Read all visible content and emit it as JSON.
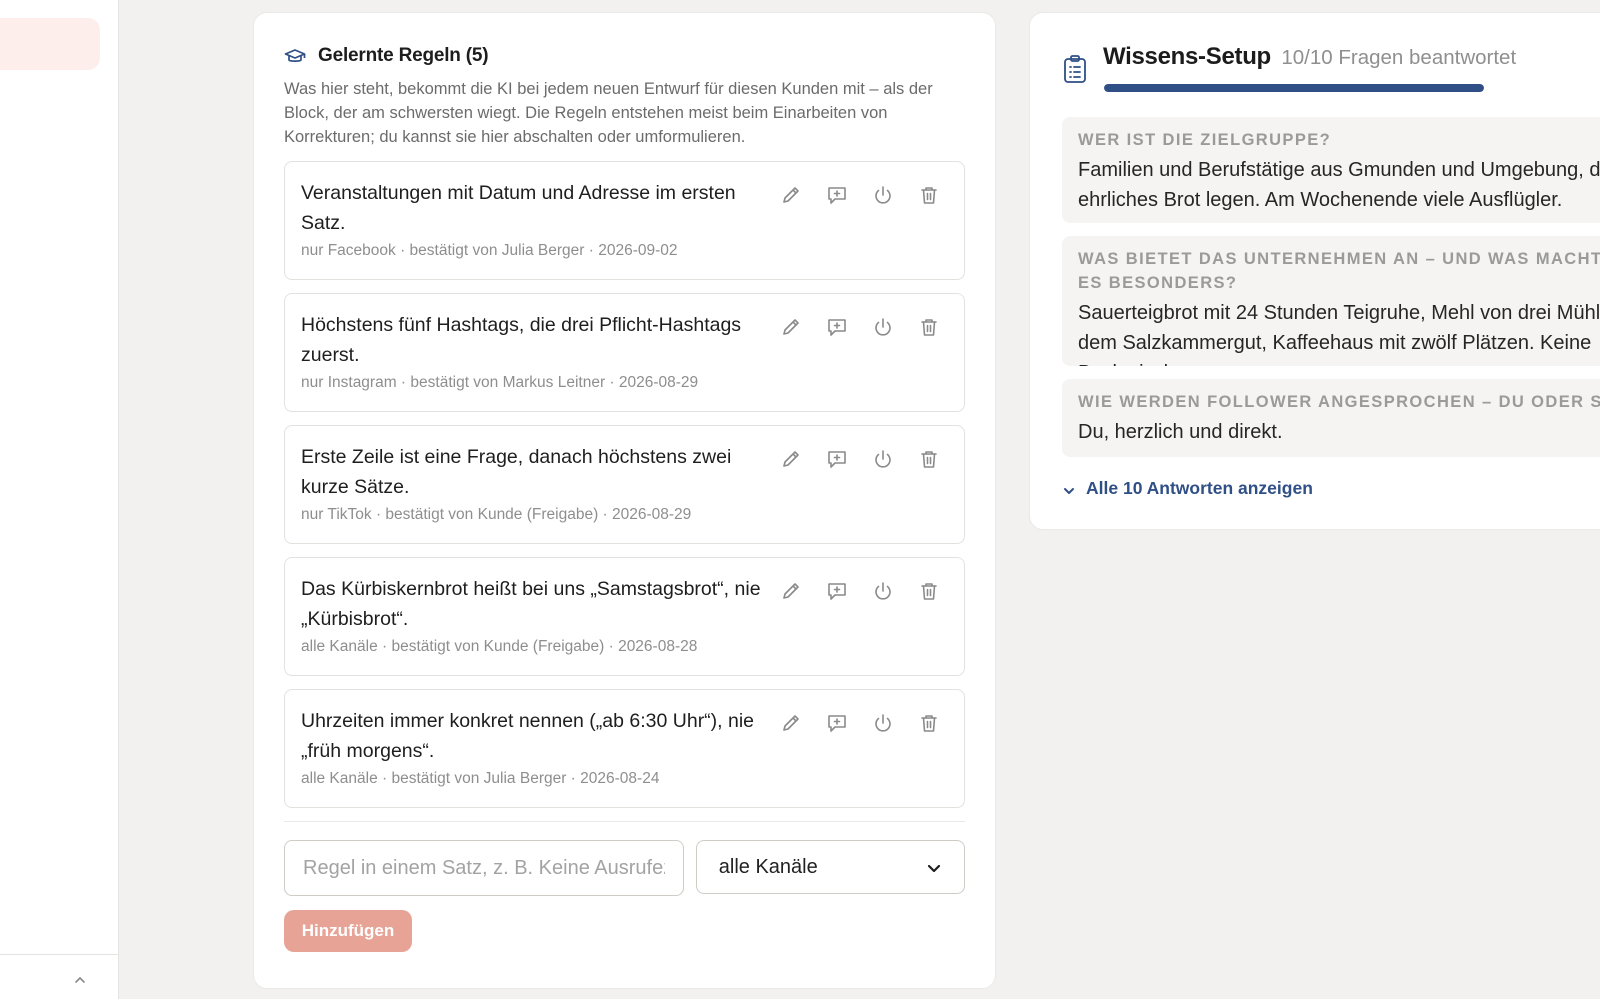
{
  "rules_panel": {
    "title": "Gelernte Regeln (5)",
    "description": "Was hier steht, bekommt die KI bei jedem neuen Entwurf für diesen Kunden mit – als der Block, der am schwersten wiegt. Die Regeln entstehen meist beim Einarbeiten von Korrekturen; du kannst sie hier abschalten oder umformulieren.",
    "rules": [
      {
        "text": "Veranstaltungen mit Datum und Adresse im ersten Satz.",
        "meta": "nur Facebook · bestätigt von Julia Berger · 2026-09-02"
      },
      {
        "text": "Höchstens fünf Hashtags, die drei Pflicht-Hashtags zuerst.",
        "meta": "nur Instagram · bestätigt von Markus Leitner · 2026-08-29"
      },
      {
        "text": "Erste Zeile ist eine Frage, danach höchstens zwei kurze Sätze.",
        "meta": "nur TikTok · bestätigt von Kunde (Freigabe) · 2026-08-29"
      },
      {
        "text": "Das Kürbiskernbrot heißt bei uns „Samstagsbrot“, nie „Kürbisbrot“.",
        "meta": "alle Kanäle · bestätigt von Kunde (Freigabe) · 2026-08-28"
      },
      {
        "text": "Uhrzeiten immer konkret nennen („ab 6:30 Uhr“), nie „früh morgens“.",
        "meta": "alle Kanäle · bestätigt von Julia Berger · 2026-08-24"
      }
    ],
    "action_icons": [
      "pencil-icon",
      "comment-plus-icon",
      "power-icon",
      "trash-icon"
    ],
    "input_placeholder": "Regel in einem Satz, z. B. Keine Ausrufezeichen.",
    "channel_selected": "alle Kanäle",
    "add_label": "Hinzufügen"
  },
  "setup_panel": {
    "title": "Wissens-Setup",
    "progress_text": "10/10 Fragen beantwortet",
    "progress_fraction": 1.0,
    "questions": [
      {
        "q": "WER IST DIE ZIELGRUPPE?",
        "a": "Familien und Berufstätige aus Gmunden und Umgebung, die Wert auf ehrliches Brot legen. Am Wochenende viele Ausflügler."
      },
      {
        "q": "WAS BIETET DAS UNTERNEHMEN AN – UND WAS MACHT ES BESONDERS?",
        "a": "Sauerteigbrot mit 24 Stunden Teigruhe, Mehl von drei Mühlen aus dem Salzkammergut, Kaffeehaus mit zwölf Plätzen. Keine Backmischungen."
      },
      {
        "q": "WIE WERDEN FOLLOWER ANGESPROCHEN – DU ODER SIE?",
        "a": "Du, herzlich und direkt."
      }
    ],
    "show_all_label": "Alle 10 Antworten anzeigen"
  },
  "colors": {
    "accent": "#2f4f86",
    "button": "#e8a397",
    "sidebar_active": "#fdeeec"
  }
}
